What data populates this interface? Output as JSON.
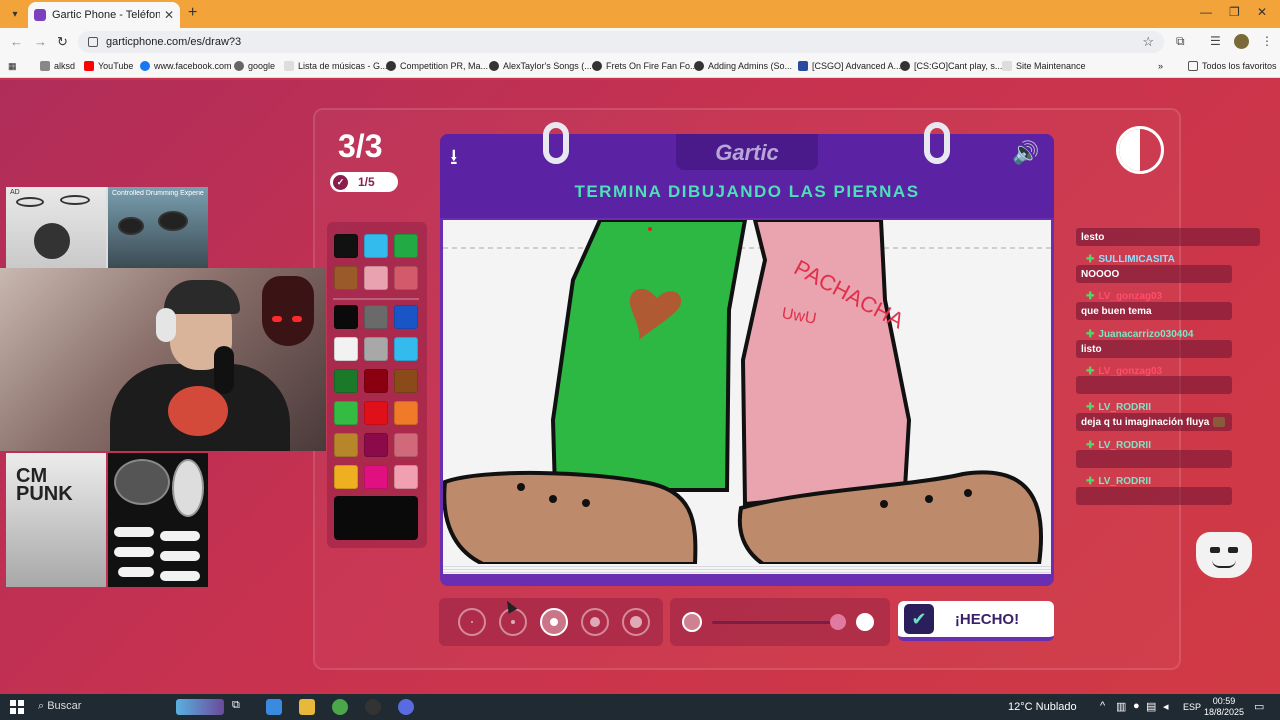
{
  "browser": {
    "tab_title": "Gartic Phone - Teléfono Descom",
    "url": "garticphone.com/es/draw?3",
    "bookmarks": [
      {
        "label": "alksd",
        "color": "#888888"
      },
      {
        "label": "YouTube",
        "color": "#ff0000"
      },
      {
        "label": "www.facebook.com",
        "color": "#1877f2"
      },
      {
        "label": "google",
        "color": "#666666"
      },
      {
        "label": "Lista de músicas - G...",
        "color": "#dddddd"
      },
      {
        "label": "Competition PR, Ma...",
        "color": "#333333"
      },
      {
        "label": "AlexTaylor's Songs (...",
        "color": "#333333"
      },
      {
        "label": "Frets On Fire Fan Fo...",
        "color": "#333333"
      },
      {
        "label": "Adding Admins (So...",
        "color": "#333333"
      },
      {
        "label": "[CSGO] Advanced A...",
        "color": "#2a4aa0"
      },
      {
        "label": "[CS:GO]Cant play, s...",
        "color": "#333333"
      },
      {
        "label": "Site Maintenance",
        "color": "#dddddd"
      }
    ],
    "all_favorites": "Todos los favoritos"
  },
  "game": {
    "round": "3/3",
    "votes": "1/5",
    "logo": "Gartic",
    "prompt": "TERMINA DIBUJANDO LAS PIERNAS",
    "done_label": "¡HECHO!",
    "drawing_text": "PACHACHA",
    "drawing_subtext": "UwU",
    "palette": [
      "#111111",
      "#33bbee",
      "#22aa44",
      "#9a5a2a",
      "#e9a3b0",
      "#d35a6a",
      "#0a0a0a",
      "#6a6a6a",
      "#1a55c8",
      "#f2f2f2",
      "#a8a8a8",
      "#33bbee",
      "#1a7a2a",
      "#8a0010",
      "#8a4a1a",
      "#33bb44",
      "#e0101a",
      "#ee7a2a",
      "#b8862a",
      "#8a0a4a",
      "#d06a7a",
      "#eeb020",
      "#e01080",
      "#f0a0b0"
    ],
    "current_color": "#0a0a0a",
    "brush_sizes": [
      "size-1",
      "size-2",
      "size-3",
      "size-4",
      "size-5"
    ],
    "selected_brush": 2
  },
  "chat": [
    {
      "type": "msg",
      "text": "lesto"
    },
    {
      "type": "name",
      "name": "SULLIMICASITA",
      "style": "blue"
    },
    {
      "type": "msg",
      "text": "NOOOO"
    },
    {
      "type": "name",
      "name": "LV_gonzag03",
      "style": "red"
    },
    {
      "type": "msg",
      "text": "que buen tema"
    },
    {
      "type": "name",
      "name": "Juanacarrizo030404",
      "style": "teal"
    },
    {
      "type": "msg",
      "text": "listo"
    },
    {
      "type": "name",
      "name": "LV_gonzag03",
      "style": "red"
    },
    {
      "type": "name",
      "name": "LV_RODRII",
      "style": "teal"
    },
    {
      "type": "msg",
      "text": "deja q tu imaginación fluya"
    },
    {
      "type": "name",
      "name": "LV_RODRII",
      "style": "teal"
    },
    {
      "type": "name",
      "name": "LV_RODRII",
      "style": "teal"
    }
  ],
  "overlay": {
    "ad_label": "AD",
    "ad_text": "Controlled Drumming Experie",
    "punk_text": "CM PUNK"
  },
  "taskbar": {
    "search": "Buscar",
    "weather": "12°C  Nublado",
    "lang": "ESP",
    "time": "00:59",
    "date": "18/8/2025"
  }
}
